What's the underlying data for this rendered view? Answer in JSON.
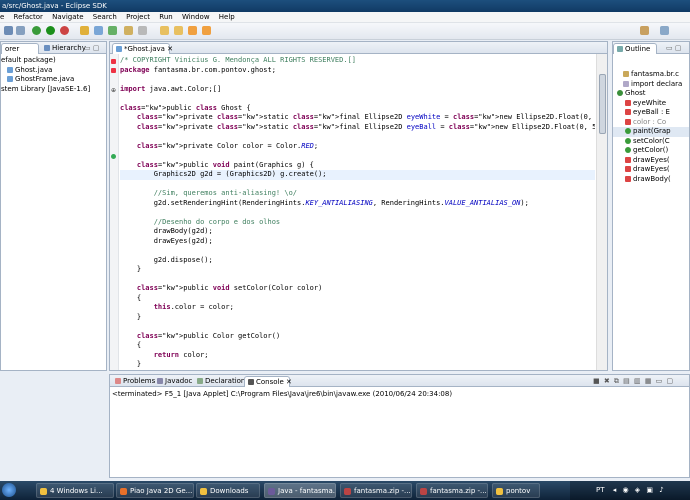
{
  "window": {
    "title": "a/src/Ghost.java - Eclipse SDK"
  },
  "menu": [
    "e",
    "Refactor",
    "Navigate",
    "Search",
    "Project",
    "Run",
    "Window",
    "Help"
  ],
  "explorer": {
    "tabs": [
      "orer",
      "Hierarchy"
    ],
    "items": [
      "efault package)",
      "Ghost.java",
      "GhostFrame.java",
      "stem Library [JavaSE-1.6]"
    ]
  },
  "editor": {
    "tab": "*Ghost.java",
    "lines": [
      {
        "text": "/* COPYRIGHT Vinicius G. Mendonça ALL RIGHTS RESERVED.[]"
      },
      {
        "text": "package fantasma.br.com.pontov.ghost;"
      },
      {
        "text": ""
      },
      {
        "text": "import java.awt.Color;[]"
      },
      {
        "text": ""
      },
      {
        "text": "public class Ghost {"
      },
      {
        "text": "    private static final Ellipse2D eyeWhite = new Ellipse2D.Float(0, 0, 20, 25);"
      },
      {
        "text": "    private static final Ellipse2D eyeBall = new Ellipse2D.Float(0, 5, 8, 15);"
      },
      {
        "text": ""
      },
      {
        "text": "    private Color color = Color.RED;"
      },
      {
        "text": ""
      },
      {
        "text": "    public void paint(Graphics g) {"
      },
      {
        "text": "        Graphics2D g2d = (Graphics2D) g.create();"
      },
      {
        "text": ""
      },
      {
        "text": "        //Sim, queremos anti-aliasing! \\o/"
      },
      {
        "text": "        g2d.setRenderingHint(RenderingHints.KEY_ANTIALIASING, RenderingHints.VALUE_ANTIALIAS_ON);"
      },
      {
        "text": ""
      },
      {
        "text": "        //Desenho do corpo e dos olhos"
      },
      {
        "text": "        drawBody(g2d);"
      },
      {
        "text": "        drawEyes(g2d);"
      },
      {
        "text": ""
      },
      {
        "text": "        g2d.dispose();"
      },
      {
        "text": "    }"
      },
      {
        "text": ""
      },
      {
        "text": "    public void setColor(Color color)"
      },
      {
        "text": "    {"
      },
      {
        "text": "        this.color = color;"
      },
      {
        "text": "    }"
      },
      {
        "text": ""
      },
      {
        "text": "    public Color getColor()"
      },
      {
        "text": "    {"
      },
      {
        "text": "        return color;"
      },
      {
        "text": "    }"
      }
    ]
  },
  "outline": {
    "tab": "Outline",
    "items": [
      "fantasma.br.c",
      "import declara",
      "Ghost",
      "eyeWhite",
      "eyeBall : E",
      "color : Co",
      "paint(Grap",
      "setColor(C",
      "getColor()",
      "drawEyes(",
      "drawEyes(",
      "drawBody("
    ]
  },
  "console": {
    "tabs": [
      "Problems",
      "Javadoc",
      "Declaration",
      "Console"
    ],
    "line": "<terminated> F5_1 [Java Applet] C:\\Program Files\\Java\\jre6\\bin\\javaw.exe (2010/06/24 20:34:08)"
  },
  "taskbar": {
    "items": [
      "4 Windows Li...",
      "Piao Java 2D Ge...",
      "Downloads",
      "Java - fantasma...",
      "fantasma.zip -...",
      "fantasma.zip -...",
      "pontov"
    ],
    "tray_lang": "PT"
  }
}
